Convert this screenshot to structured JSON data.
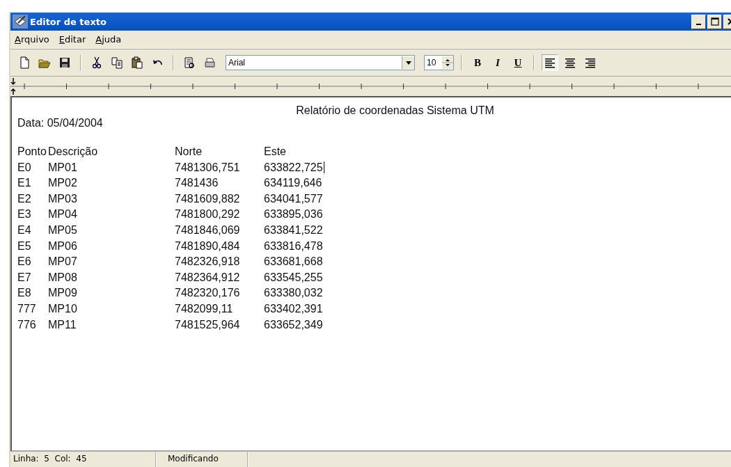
{
  "window": {
    "title": "Editor de texto"
  },
  "menu": [
    {
      "access_key": "A",
      "rest": "rquivo"
    },
    {
      "access_key": "E",
      "rest": "ditar"
    },
    {
      "access_key": "A",
      "rest": "juda"
    }
  ],
  "toolbar": {
    "font": "Arial",
    "size": "10",
    "format": [
      {
        "label": "B",
        "kind": "bold",
        "selected": false
      },
      {
        "label": "I",
        "kind": "italic",
        "selected": false
      },
      {
        "label": "U",
        "kind": "underline",
        "selected": false
      }
    ],
    "align": [
      {
        "kind": "left",
        "selected": true
      },
      {
        "kind": "center",
        "selected": false
      },
      {
        "kind": "right",
        "selected": false
      }
    ]
  },
  "document": {
    "title": "Relatório de coordenadas Sistema UTM",
    "date": "Data: 05/04/2004",
    "columns": [
      "Ponto",
      "Descrição",
      "Norte",
      "Este"
    ],
    "rows": [
      [
        "E0",
        "MP01",
        "7481306,751",
        "633822,725"
      ],
      [
        "E1",
        "MP02",
        "7481436",
        "634119,646"
      ],
      [
        "E2",
        "MP03",
        "7481609,882",
        "634041,577"
      ],
      [
        "E3",
        "MP04",
        "7481800,292",
        "633895,036"
      ],
      [
        "E4",
        "MP05",
        "7481846,069",
        "633841,522"
      ],
      [
        "E5",
        "MP06",
        "7481890,484",
        "633816,478"
      ],
      [
        "E6",
        "MP07",
        "7482326,918",
        "633681,668"
      ],
      [
        "E7",
        "MP08",
        "7482364,912",
        "633545,255"
      ],
      [
        "E8",
        "MP09",
        "7482320,176",
        "633380,032"
      ],
      [
        "777",
        "MP10",
        "7482099,11",
        "633402,391"
      ],
      [
        "776",
        "MP11",
        "7481525,964",
        "633652,349"
      ]
    ]
  },
  "status_bar": {
    "position": "Linha:  5  Col:  45",
    "mode": "Modificando"
  }
}
